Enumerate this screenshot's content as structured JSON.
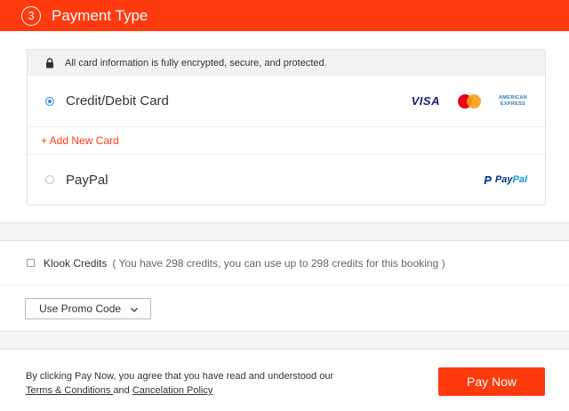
{
  "header": {
    "step": "3",
    "title": "Payment Type"
  },
  "payment": {
    "secure_notice": "All card information is fully encrypted, secure, and protected.",
    "options": [
      {
        "label": "Credit/Debit Card",
        "selected": true
      },
      {
        "label": "PayPal",
        "selected": false
      }
    ],
    "add_card_label": "+ Add New Card",
    "logos": {
      "visa": "VISA",
      "amex_line1": "AMERICAN",
      "amex_line2": "EXPRESS",
      "paypal_pay": "Pay",
      "paypal_pal": "Pal",
      "paypal_mark": "P"
    }
  },
  "credits": {
    "label": "Klook Credits",
    "note": "( You have 298 credits, you can use up to 298 credits for this booking )",
    "checked": false
  },
  "promo": {
    "button_label": "Use Promo Code"
  },
  "footer": {
    "terms_prefix": "By clicking Pay Now, you agree that you have read and understood our",
    "terms_link": "Terms & Conditions ",
    "terms_and": "and",
    "cancel_link": "Cancelation Policy",
    "pay_label": "Pay Now"
  },
  "colors": {
    "accent": "#ff3a0f",
    "radio": "#2d8cf0",
    "visa": "#1a1f71",
    "paypal": "#003087"
  },
  "icons": [
    "lock-icon",
    "chevron-down-icon",
    "visa-logo",
    "mastercard-logo",
    "amex-logo",
    "paypal-logo"
  ]
}
